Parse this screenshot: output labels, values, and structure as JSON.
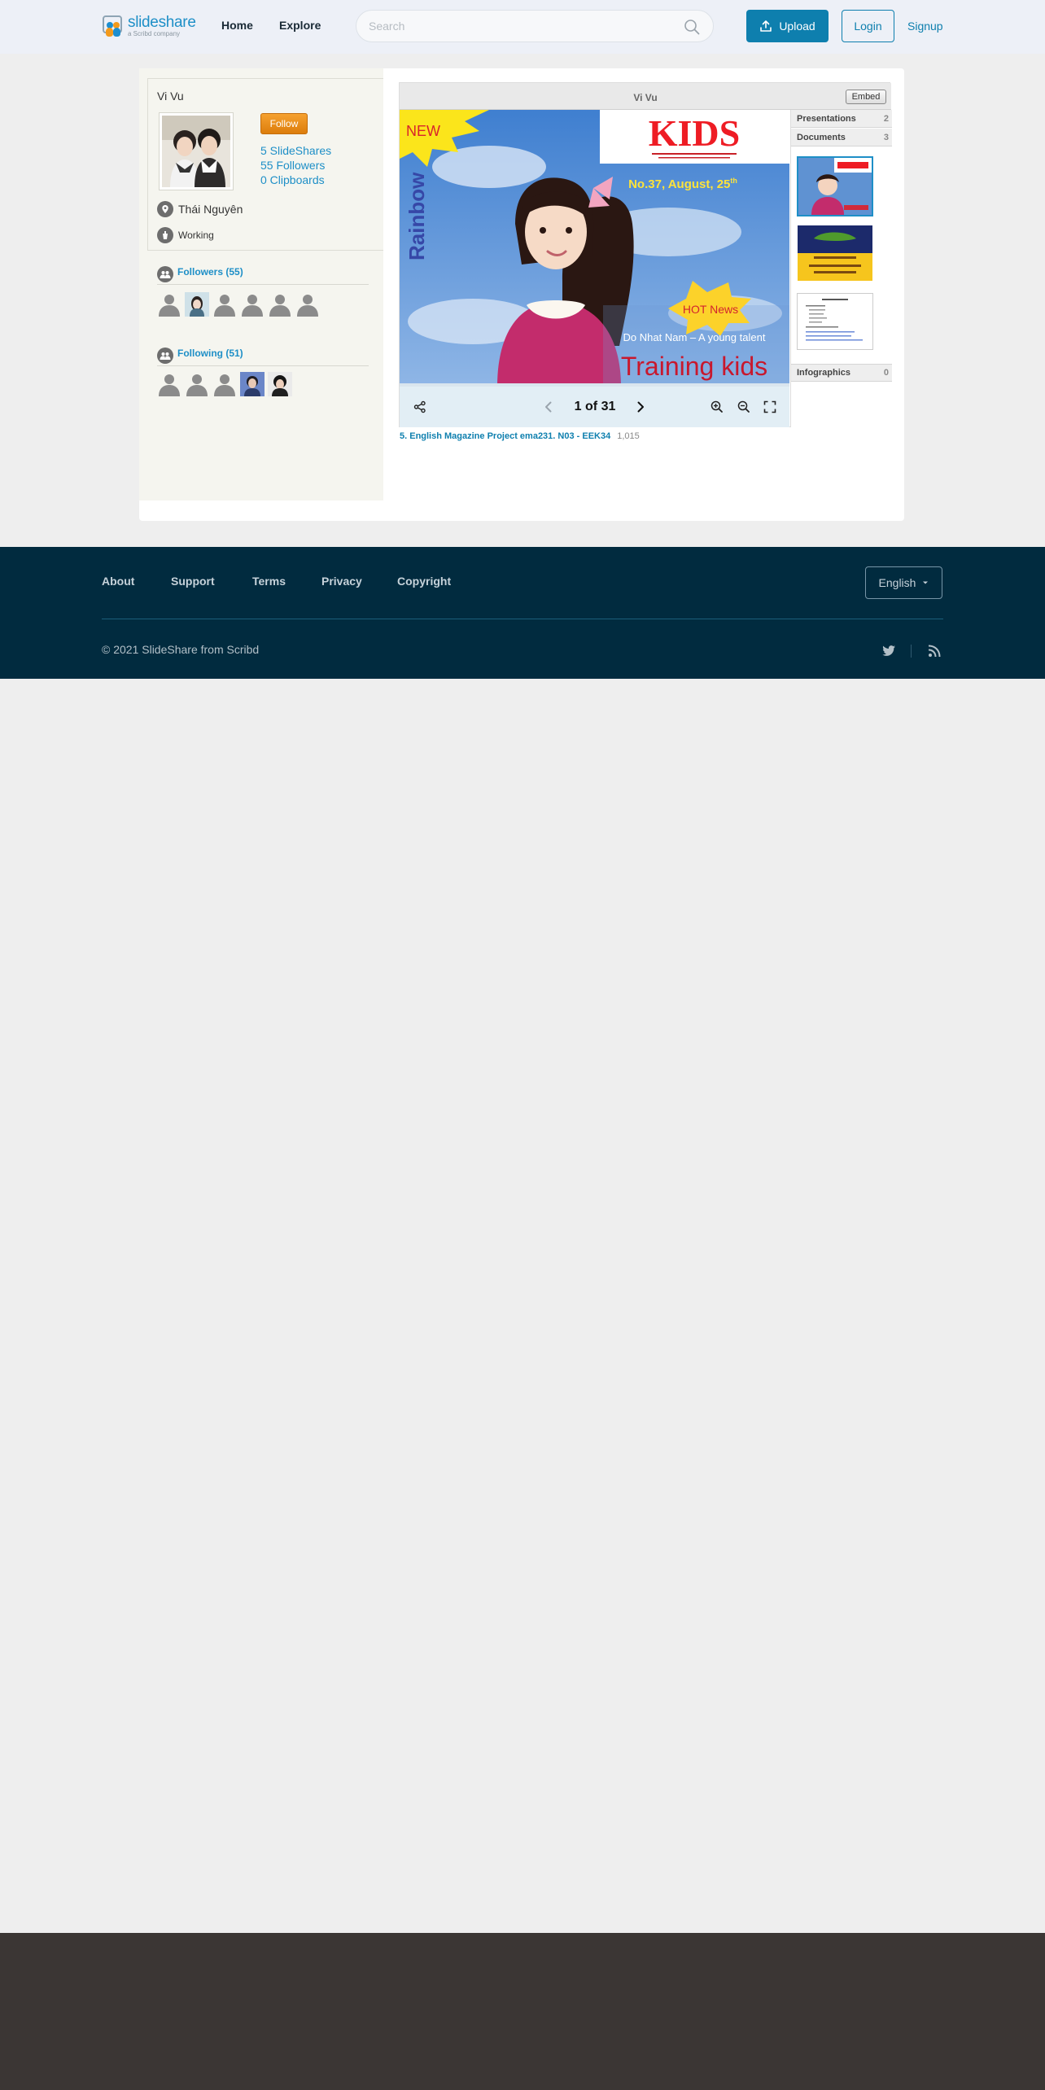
{
  "header": {
    "logo_word": "slideshare",
    "logo_sub": "a Scribd company",
    "nav": [
      "Home",
      "Explore"
    ],
    "search_placeholder": "Search",
    "upload_label": "Upload",
    "login_label": "Login",
    "signup_label": "Signup"
  },
  "profile": {
    "name": "Vi Vu",
    "follow_label": "Follow",
    "stats": [
      "5 SlideShares",
      "55 Followers",
      "0 Clipboards"
    ],
    "location": "Thái Nguyên",
    "occupation": "Working",
    "followers_label": "Followers (55)",
    "following_label": "Following (51)"
  },
  "viewer": {
    "title": "Vi Vu",
    "embed_label": "Embed",
    "page_current": "1",
    "page_sep": "of",
    "page_total": "31",
    "slide": {
      "badge": "NEW",
      "brand": "KIDS",
      "issue": "No.37, August, 25",
      "issue_sup": "th",
      "side_text": "Rainbow",
      "burst": "HOT  News",
      "subtitle": "Do Nhat Nam – A young talent",
      "headline": "Training kids"
    },
    "tabs": [
      {
        "label": "Presentations",
        "count": "2"
      },
      {
        "label": "Documents",
        "count": "3"
      },
      {
        "label": "Infographics",
        "count": "0"
      }
    ],
    "doc_title": "5. English Magazine Project ema231. N03 - EEK34",
    "doc_views": "1,015"
  },
  "footer": {
    "links": [
      "About",
      "Support",
      "Terms",
      "Privacy",
      "Copyright"
    ],
    "language": "English",
    "copyright": "© 2021 SlideShare from Scribd"
  },
  "colors": {
    "brand_blue": "#0e7fae",
    "link_blue": "#1e8fc7",
    "follow_orange": "#f39a1c",
    "footer_bg": "#012b3f"
  }
}
